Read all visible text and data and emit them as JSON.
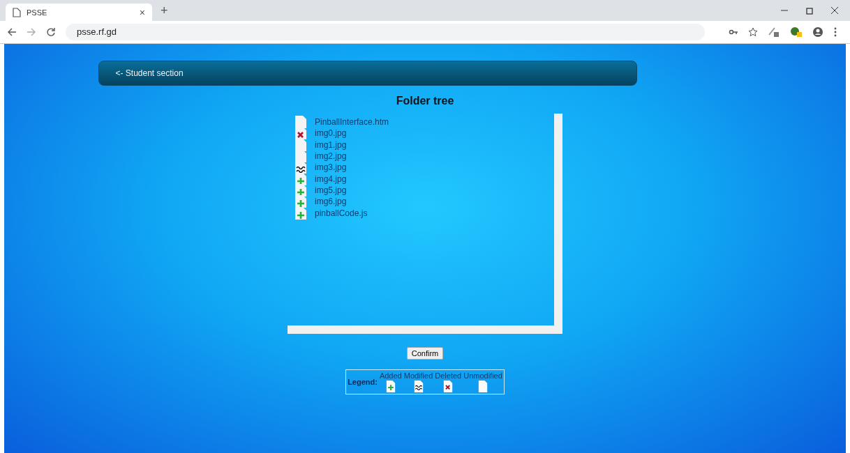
{
  "browser": {
    "tab_title": "PSSE",
    "tab_close": "×",
    "new_tab": "+",
    "url": "psse.rf.gd"
  },
  "nav": {
    "back_link": "<- Student section"
  },
  "title": "Folder tree",
  "files": [
    {
      "name": "PinballInterface.htm",
      "kind": "unmodified"
    },
    {
      "name": "img0.jpg",
      "kind": "deleted"
    },
    {
      "name": "img1.jpg",
      "kind": "unmodified"
    },
    {
      "name": "img2.jpg",
      "kind": "unmodified"
    },
    {
      "name": "img3.jpg",
      "kind": "modified"
    },
    {
      "name": "img4.jpg",
      "kind": "added"
    },
    {
      "name": "img5.jpg",
      "kind": "added"
    },
    {
      "name": "img6.jpg",
      "kind": "added"
    },
    {
      "name": "pinballCode.js",
      "kind": "added"
    }
  ],
  "confirm_button": "Confirm",
  "legend": {
    "label": "Legend:",
    "items": [
      {
        "label": "Added",
        "kind": "added"
      },
      {
        "label": "Modified",
        "kind": "modified"
      },
      {
        "label": "Deleted",
        "kind": "deleted"
      },
      {
        "label": "Unmodified",
        "kind": "unmodified"
      }
    ]
  }
}
